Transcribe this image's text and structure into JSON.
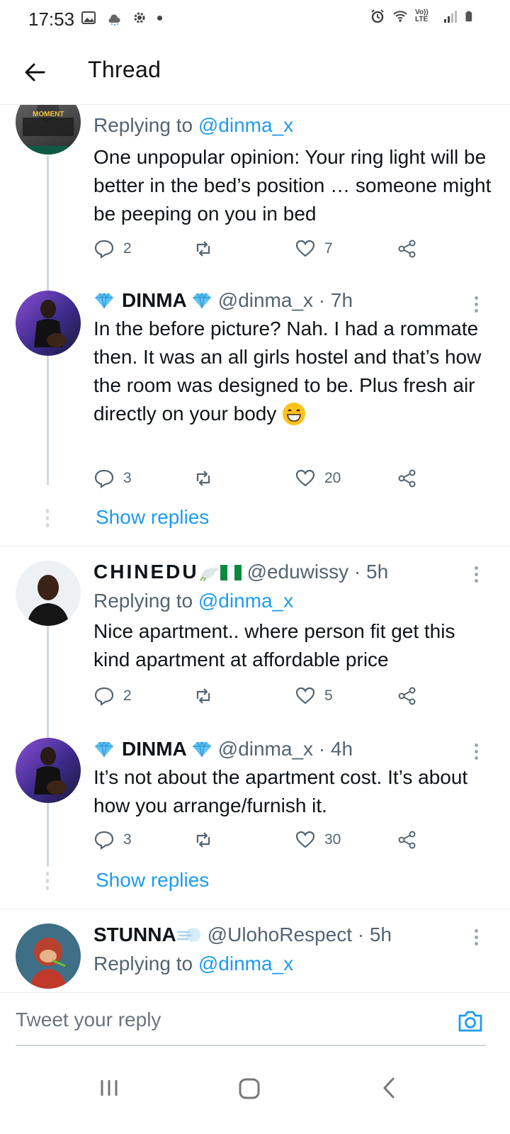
{
  "status_bar": {
    "time": "17:53",
    "right_label": "Vo)) LTE"
  },
  "header": {
    "title": "Thread"
  },
  "tweets": [
    {
      "replying_prefix": "Replying to",
      "replying_to": "@dinma_x",
      "avatar_text": "MOMENT",
      "text": "One unpopular opinion: Your ring light will be better in the bed’s position … someone might be peeping on you in bed",
      "replies": "2",
      "likes": "7"
    },
    {
      "name": "DINMA",
      "handle_time": "@dinma_x · 7h",
      "text": "In the before picture?  Nah. I had a rommate then. It was an all girls hostel and that’s how the room was designed to be. Plus fresh air directly on your body",
      "replies": "3",
      "likes": "20",
      "show_replies": "Show replies"
    },
    {
      "name": "CHINEDU",
      "handle_time": "@eduwissy · 5h",
      "replying_prefix": "Replying to",
      "replying_to": "@dinma_x",
      "text": "Nice apartment.. where person fit get this kind apartment at affordable price",
      "replies": "2",
      "likes": "5"
    },
    {
      "name": "DINMA",
      "handle_time": "@dinma_x · 4h",
      "text": "It’s not about the apartment cost. It’s about how you arrange/furnish it.",
      "replies": "3",
      "likes": "30",
      "show_replies": "Show replies"
    },
    {
      "name": "STUNNA",
      "handle_time": "@UlohoRespect · 5h",
      "replying_prefix": "Replying to",
      "replying_to": "@dinma_x"
    }
  ],
  "reply_bar": {
    "placeholder": "Tweet your reply"
  },
  "colors": {
    "accent": "#1d9bf0",
    "secondary_text": "#536471",
    "divider": "#e6ecf0"
  }
}
